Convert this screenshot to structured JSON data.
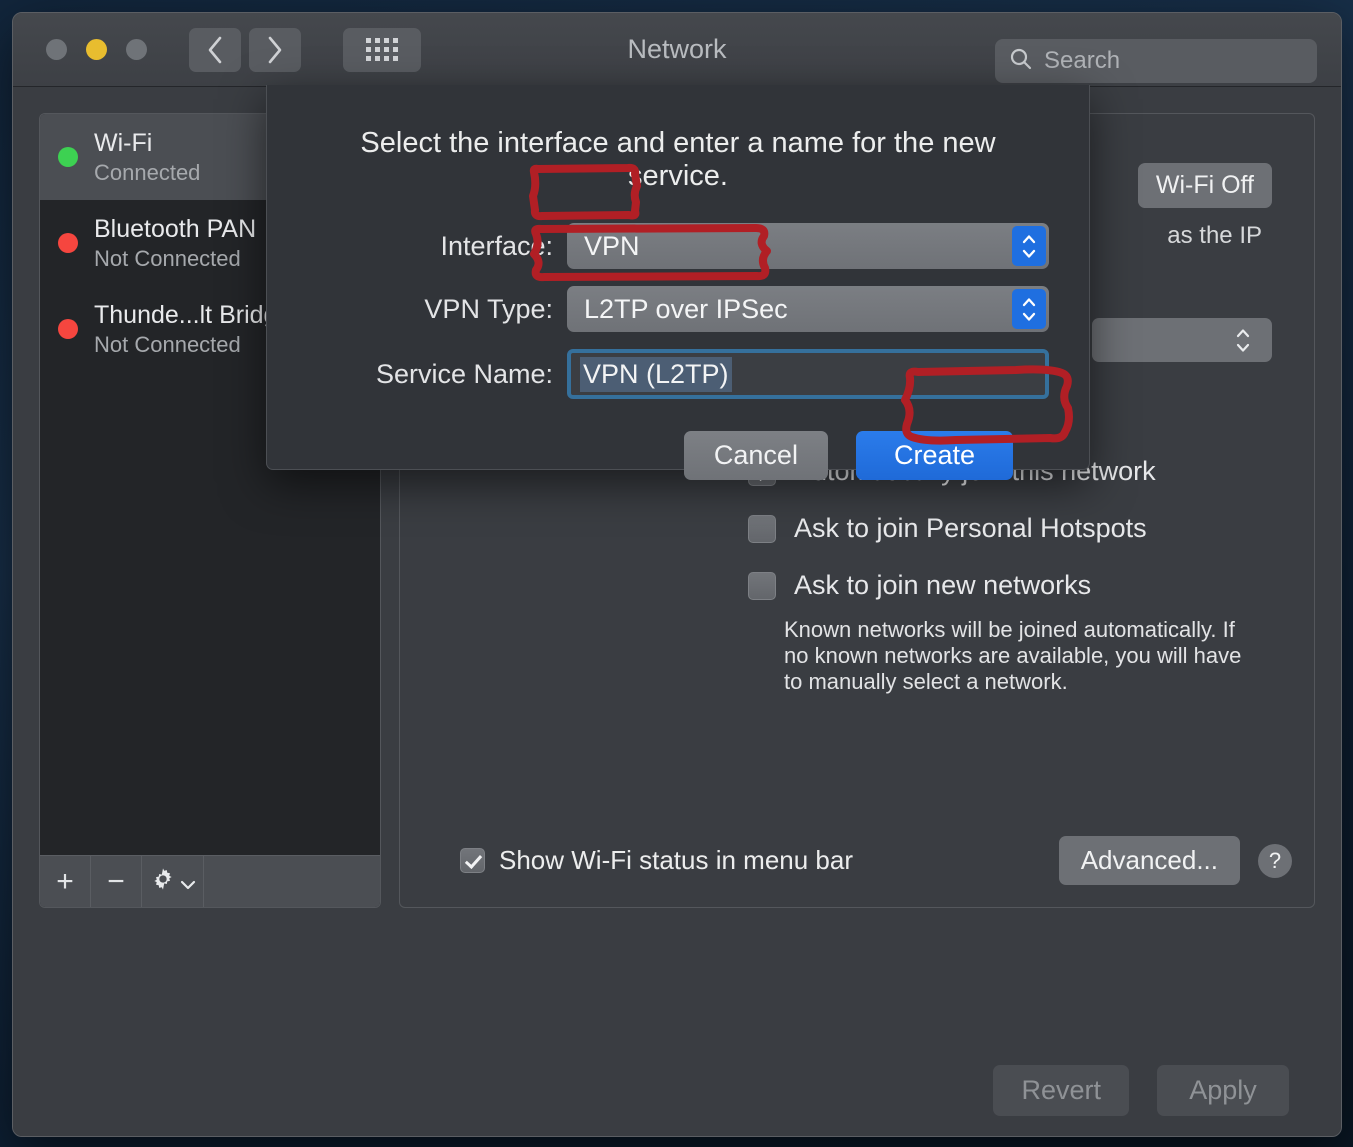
{
  "window": {
    "title": "Network",
    "traffic_lights": [
      "close",
      "minimize",
      "maximize"
    ],
    "search": {
      "placeholder": "Search"
    }
  },
  "sidebar": {
    "items": [
      {
        "name": "Wi-Fi",
        "status": "Connected",
        "led": "green",
        "selected": true
      },
      {
        "name": "Bluetooth PAN",
        "status": "Not Connected",
        "led": "red",
        "selected": false
      },
      {
        "name": "Thunde...lt Bridge",
        "status": "Not Connected",
        "led": "red",
        "selected": false
      }
    ],
    "toolbar": {
      "add_label": "+",
      "remove_label": "−",
      "gear_label": "⚙"
    }
  },
  "pane": {
    "wifi_off_button": "Wi-Fi Off",
    "ip_fragment": "as the IP",
    "checkboxes": [
      {
        "label": "Automatically join this network",
        "checked": true
      },
      {
        "label": "Ask to join Personal Hotspots",
        "checked": false
      },
      {
        "label": "Ask to join new networks",
        "checked": false
      }
    ],
    "hint": "Known networks will be joined automatically. If no known networks are available, you will have to manually select a network.",
    "footer": {
      "show_status_label": "Show Wi-Fi status in menu bar",
      "show_status_checked": true,
      "advanced_button": "Advanced...",
      "help_button": "?"
    }
  },
  "action_bar": {
    "revert_button": "Revert",
    "apply_button": "Apply",
    "revert_enabled": false,
    "apply_enabled": false
  },
  "sheet": {
    "title": "Select the interface and enter a name for the new service.",
    "fields": [
      {
        "label": "Interface:",
        "value": "VPN",
        "type": "popup"
      },
      {
        "label": "VPN Type:",
        "value": "L2TP over IPSec",
        "type": "popup"
      },
      {
        "label": "Service Name:",
        "value": "VPN (L2TP)",
        "type": "text",
        "selected": true
      }
    ],
    "cancel_button": "Cancel",
    "create_button": "Create"
  },
  "annotations": {
    "color": "#b11f25",
    "targets": [
      "interface-value",
      "vpn-type-value",
      "create-button"
    ]
  },
  "colors": {
    "accent_blue": "#1f6fe0",
    "create_blue": "#2b7ceb",
    "annotation_red": "#b11f25",
    "led_green": "#3dd152",
    "led_red": "#f6463f",
    "window_bg": "#3a3d42",
    "sheet_bg": "#313439"
  }
}
